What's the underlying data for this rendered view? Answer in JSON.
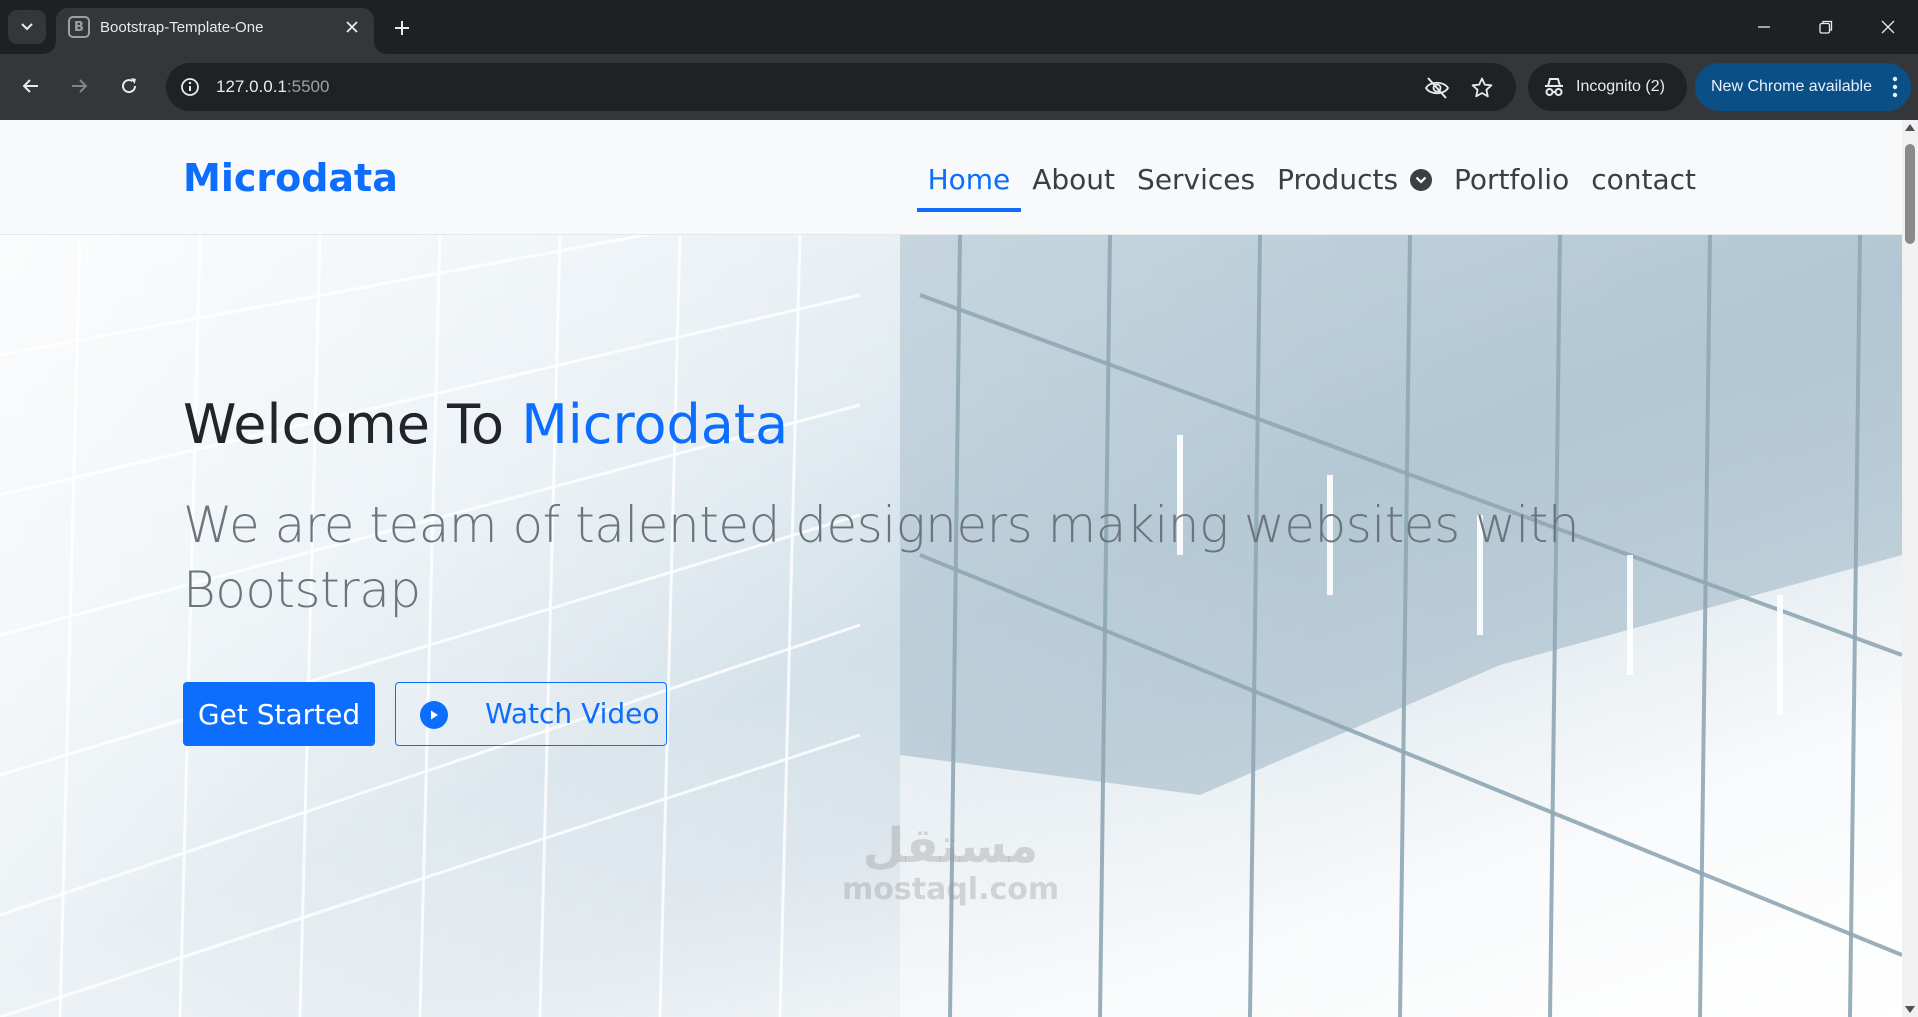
{
  "browser": {
    "tab": {
      "title": "Bootstrap-Template-One",
      "favicon_letter": "B"
    },
    "address": {
      "host": "127.0.0.1",
      "port": ":5500"
    },
    "incognito_label": "Incognito (2)",
    "update_label": "New Chrome available"
  },
  "site": {
    "brand": "Microdata",
    "nav": {
      "home": "Home",
      "about": "About",
      "services": "Services",
      "products": "Products",
      "portfolio": "Portfolio",
      "contact": "contact"
    },
    "hero": {
      "title_prefix": "Welcome To ",
      "title_accent": "Microdata",
      "subtitle": "We are team of talented designers making websites with Bootstrap",
      "primary_button": "Get Started",
      "secondary_button": "Watch Video"
    },
    "watermark": {
      "arabic": "مستقل",
      "latin": "mostaql.com"
    }
  },
  "colors": {
    "primary": "#0d6efd",
    "toolbar": "#35363a",
    "tabstrip": "#1f2023",
    "update_chip": "#0b4f87"
  },
  "icons": [
    "tab-search-icon",
    "favicon-icon",
    "close-icon",
    "plus-icon",
    "minimize-icon",
    "restore-icon",
    "window-close-icon",
    "back-arrow-icon",
    "forward-arrow-icon",
    "reload-icon",
    "site-info-icon",
    "eye-off-icon",
    "star-icon",
    "incognito-icon",
    "kebab-menu-icon",
    "chevron-down-icon",
    "play-icon"
  ]
}
